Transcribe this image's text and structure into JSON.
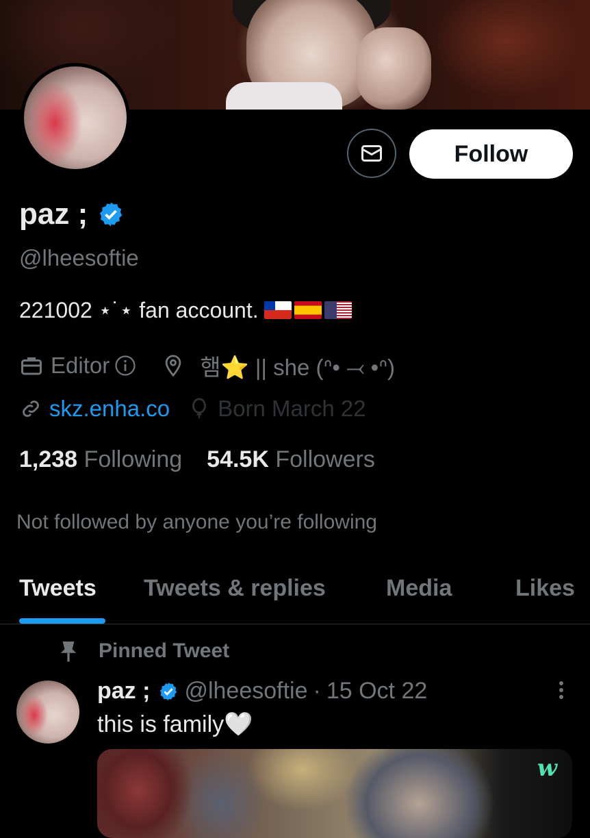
{
  "profile": {
    "name": "paz ;",
    "handle": "@lheesoftie",
    "bio_text": "221002 ⋆˙⋆ fan account.",
    "profession": "Editor",
    "location": "햄⭐ || she (ᐢ• ⤙ •ᐢ)",
    "website": "skz.enha.co",
    "birthday": "Born March 22",
    "following_count": "1,238",
    "following_label": "Following",
    "followers_count": "54.5K",
    "followers_label": "Followers",
    "not_followed_text": "Not followed by anyone you’re following"
  },
  "actions": {
    "follow_label": "Follow"
  },
  "tabs": [
    {
      "label": "Tweets",
      "active": true
    },
    {
      "label": "Tweets & replies",
      "active": false
    },
    {
      "label": "Media",
      "active": false
    },
    {
      "label": "Likes",
      "active": false
    }
  ],
  "pinned_tweet": {
    "pinned_label": "Pinned Tweet",
    "name": "paz ;",
    "handle": "@lheesoftie",
    "separator": "·",
    "date": "15 Oct 22",
    "text": "this is family🤍",
    "media_watermark": "w"
  },
  "icons": {
    "verified": "verified-badge-icon",
    "mail": "mail-icon",
    "briefcase": "briefcase-icon",
    "info": "info-icon",
    "location": "location-pin-icon",
    "link": "link-icon",
    "balloon": "balloon-icon",
    "pin": "pin-icon",
    "more": "more-vertical-icon"
  },
  "colors": {
    "accent": "#1d9bf0",
    "background": "#000000",
    "text_primary": "#e7e9ea",
    "text_secondary": "#71767b"
  }
}
